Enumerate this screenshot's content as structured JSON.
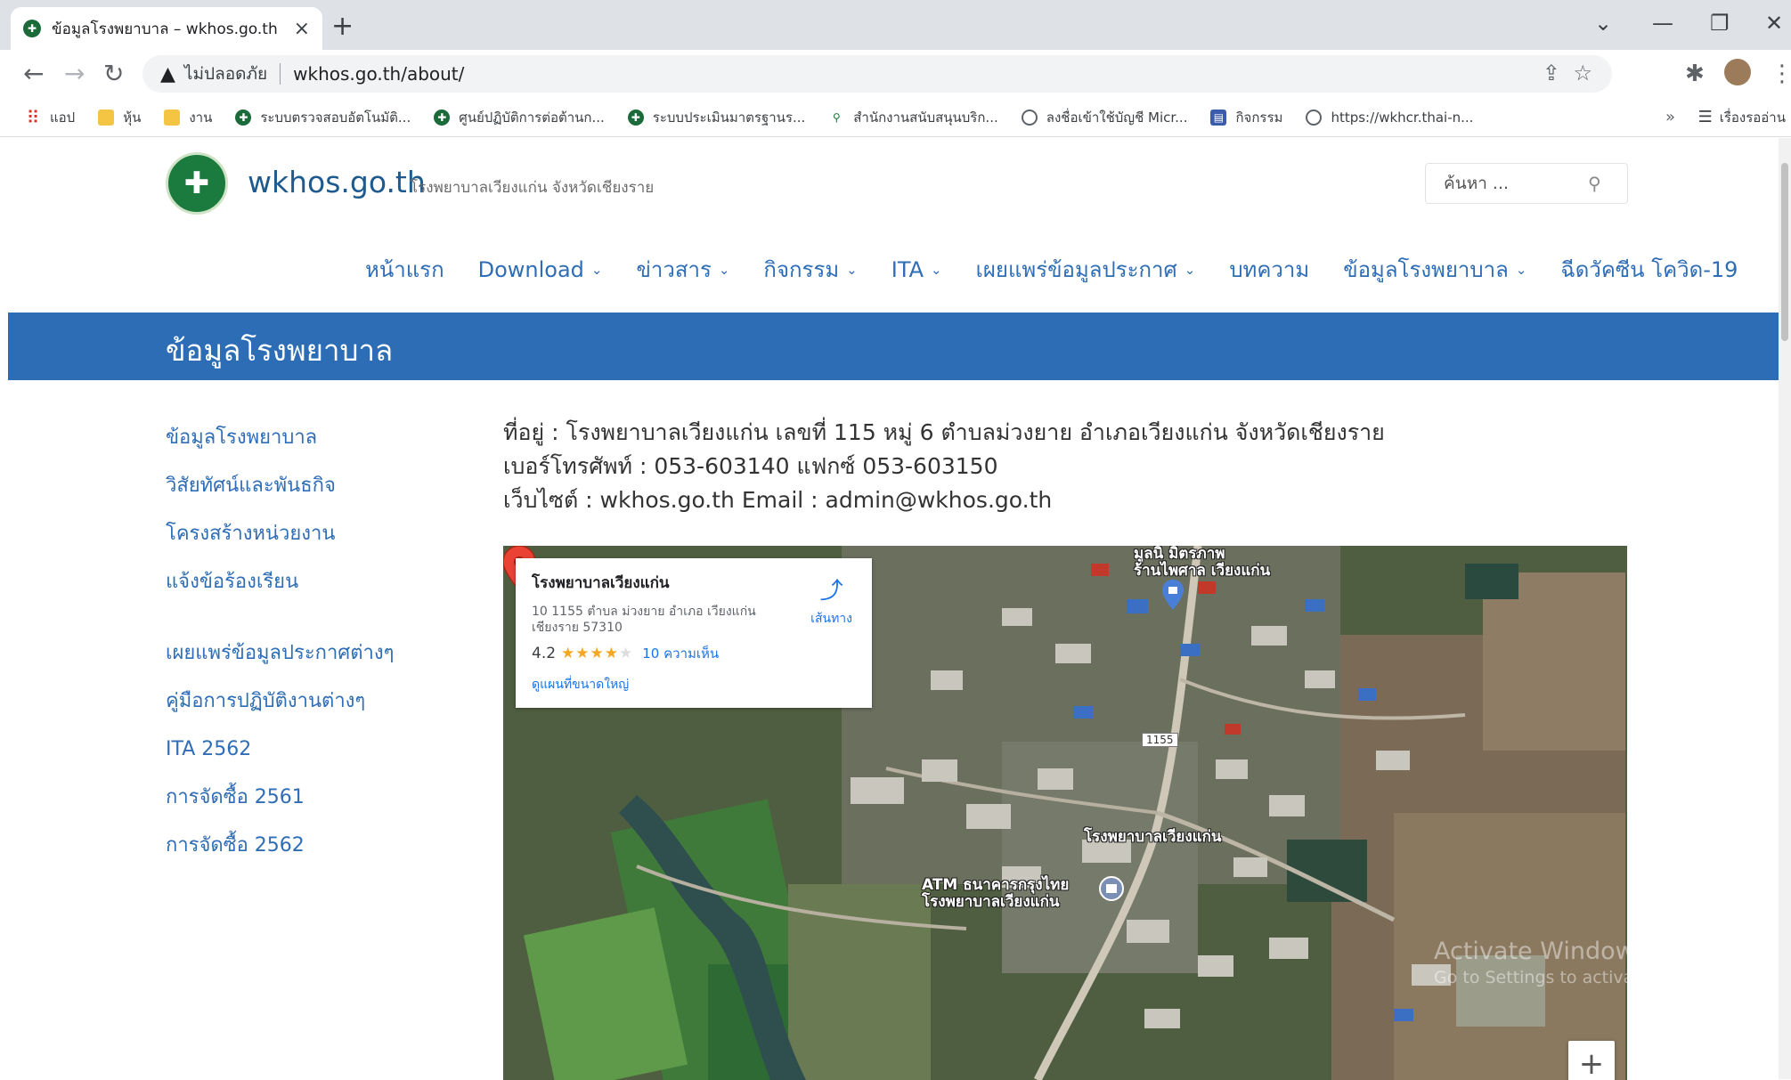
{
  "browser": {
    "tab_title": "ข้อมูลโรงพยาบาล – wkhos.go.th",
    "tab_close": "×",
    "new_tab": "+",
    "not_secure": "ไม่ปลอดภัย",
    "url": "wkhos.go.th/about/",
    "bookmarks": [
      {
        "label": "แอป",
        "icon": "apps-icon"
      },
      {
        "label": "หุ้น",
        "icon": "folder-icon"
      },
      {
        "label": "งาน",
        "icon": "folder-icon"
      },
      {
        "label": "ระบบตรวจสอบอัตโนมัติ...",
        "icon": "moph-icon"
      },
      {
        "label": "ศูนย์ปฏิบัติการต่อต้านก...",
        "icon": "moph-icon"
      },
      {
        "label": "ระบบประเมินมาตรฐานร...",
        "icon": "moph-icon"
      },
      {
        "label": "สำนักงานสนับสนุนบริก...",
        "icon": "pin-icon"
      },
      {
        "label": "ลงชื่อเข้าใช้บัญชี Micr...",
        "icon": "globe-icon"
      },
      {
        "label": "กิจกรรม",
        "icon": "calendar-icon"
      },
      {
        "label": "https://wkhcr.thai-n...",
        "icon": "globe-icon"
      }
    ],
    "bookmarks_more": "»",
    "reading_list": "เรื่องรออ่าน"
  },
  "site": {
    "name": "wkhos.go.th",
    "tagline": "โรงพยาบาลเวียงแก่น จังหวัดเชียงราย",
    "search_placeholder": "ค้นหา ..."
  },
  "nav": [
    {
      "label": "หน้าแรก",
      "dropdown": false
    },
    {
      "label": "Download",
      "dropdown": true
    },
    {
      "label": "ข่าวสาร",
      "dropdown": true
    },
    {
      "label": "กิจกรรม",
      "dropdown": true
    },
    {
      "label": "ITA",
      "dropdown": true
    },
    {
      "label": "เผยแพร่ข้อมูลประกาศ",
      "dropdown": true
    },
    {
      "label": "บทความ",
      "dropdown": false
    },
    {
      "label": "ข้อมูลโรงพยาบาล",
      "dropdown": true
    },
    {
      "label": "ฉีดวัคซีน โควิด-19",
      "dropdown": false
    }
  ],
  "banner_title": "ข้อมูลโรงพยาบาล",
  "sidebar": {
    "group1": [
      "ข้อมูลโรงพยาบาล",
      "วิสัยทัศน์และพันธกิจ",
      "โครงสร้างหน่วยงาน",
      "แจ้งข้อร้องเรียน"
    ],
    "group2": [
      "เผยแพร่ข้อมูลประกาศต่างๆ",
      "คู่มือการปฏิบัติงานต่างๆ",
      "ITA 2562",
      "การจัดซื้อ 2561",
      "การจัดซื้อ 2562"
    ]
  },
  "info": {
    "address": "ที่อยู่ : โรงพยาบาลเวียงแก่น เลขที่  115  หมู่ 6 ตำบลม่วงยาย อำเภอเวียงแก่น  จังหวัดเชียงราย",
    "phone": "เบอร์โทรศัพท์ : 053-603140  แฟกซ์ 053-603150",
    "web": "เว็บไซต์  :  wkhos.go.th  Email : admin@wkhos.go.th"
  },
  "map": {
    "card_name": "โรงพยาบาลเวียงแก่น",
    "card_address": "10 1155 ตำบล ม่วงยาย อำเภอ เวียงแก่น เชียงราย 57310",
    "rating": "4.2",
    "rating_stars": 4.2,
    "reviews": "10 ความเห็น",
    "view_larger": "ดูแผนที่ขนาดใหญ่",
    "directions": "เส้นทาง",
    "label_market_1": "มูลนิ มิตรภาพ",
    "label_market_2": "ร้านไพศาล เวียงแก่น",
    "label_hospital": "โรงพยาบาลเวียงแก่น",
    "label_atm_1": "ATM ธนาคารกรุงไทย",
    "label_atm_2": "โรงพยาบาลเวียงแก่น",
    "road_number": "1155",
    "zoom_in": "+"
  },
  "os_watermark": {
    "line1": "Activate Windows",
    "line2": "Go to Settings to activate Windows."
  }
}
